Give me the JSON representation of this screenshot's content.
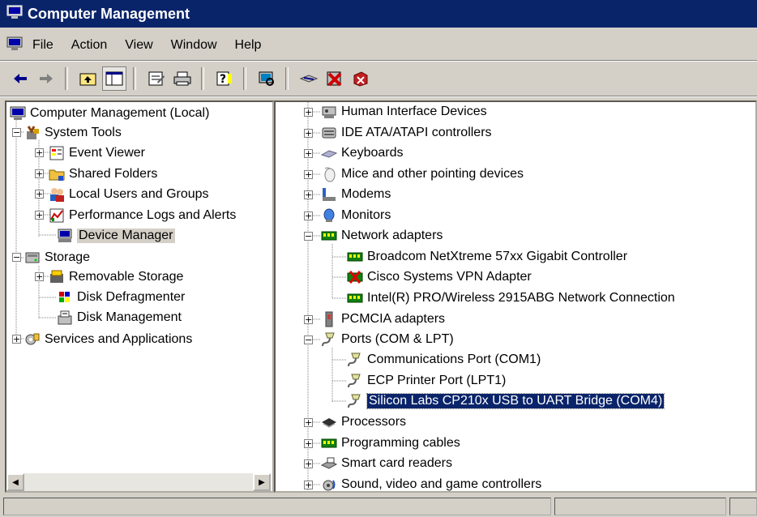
{
  "window": {
    "title": "Computer Management"
  },
  "menu": [
    "File",
    "Action",
    "View",
    "Window",
    "Help"
  ],
  "left_tree": [
    {
      "label": "Computer Management (Local)",
      "icon": "computer-icon"
    },
    {
      "label": "System Tools",
      "icon": "tools-icon"
    },
    {
      "label": "Event Viewer",
      "icon": "event-viewer-icon"
    },
    {
      "label": "Shared Folders",
      "icon": "folder-icon"
    },
    {
      "label": "Local Users and Groups",
      "icon": "users-icon"
    },
    {
      "label": "Performance Logs and Alerts",
      "icon": "performance-icon"
    },
    {
      "label": "Device Manager",
      "icon": "device-manager-icon"
    },
    {
      "label": "Storage",
      "icon": "storage-icon"
    },
    {
      "label": "Removable Storage",
      "icon": "removable-storage-icon"
    },
    {
      "label": "Disk Defragmenter",
      "icon": "defrag-icon"
    },
    {
      "label": "Disk Management",
      "icon": "disk-management-icon"
    },
    {
      "label": "Services and Applications",
      "icon": "services-icon"
    }
  ],
  "right_tree": [
    {
      "label": "Human Interface Devices",
      "icon": "hid-icon"
    },
    {
      "label": "IDE ATA/ATAPI controllers",
      "icon": "ide-icon"
    },
    {
      "label": "Keyboards",
      "icon": "keyboard-icon"
    },
    {
      "label": "Mice and other pointing devices",
      "icon": "mouse-icon"
    },
    {
      "label": "Modems",
      "icon": "modem-icon"
    },
    {
      "label": "Monitors",
      "icon": "monitor-icon"
    },
    {
      "label": "Network adapters",
      "icon": "network-adapter-icon"
    },
    {
      "label": "Broadcom NetXtreme 57xx Gigabit Controller",
      "icon": "network-adapter-icon"
    },
    {
      "label": "Cisco Systems VPN Adapter",
      "icon": "disabled-network-adapter-icon"
    },
    {
      "label": "Intel(R) PRO/Wireless 2915ABG Network Connection",
      "icon": "network-adapter-icon"
    },
    {
      "label": "PCMCIA adapters",
      "icon": "pcmcia-icon"
    },
    {
      "label": "Ports (COM & LPT)",
      "icon": "port-icon"
    },
    {
      "label": "Communications Port (COM1)",
      "icon": "port-icon"
    },
    {
      "label": "ECP Printer Port (LPT1)",
      "icon": "port-icon"
    },
    {
      "label": "Silicon Labs CP210x USB to UART Bridge (COM4)",
      "icon": "port-icon"
    },
    {
      "label": "Processors",
      "icon": "processor-icon"
    },
    {
      "label": "Programming cables",
      "icon": "network-adapter-icon"
    },
    {
      "label": "Smart card readers",
      "icon": "smart-card-icon"
    },
    {
      "label": "Sound, video and game controllers",
      "icon": "sound-icon"
    }
  ]
}
